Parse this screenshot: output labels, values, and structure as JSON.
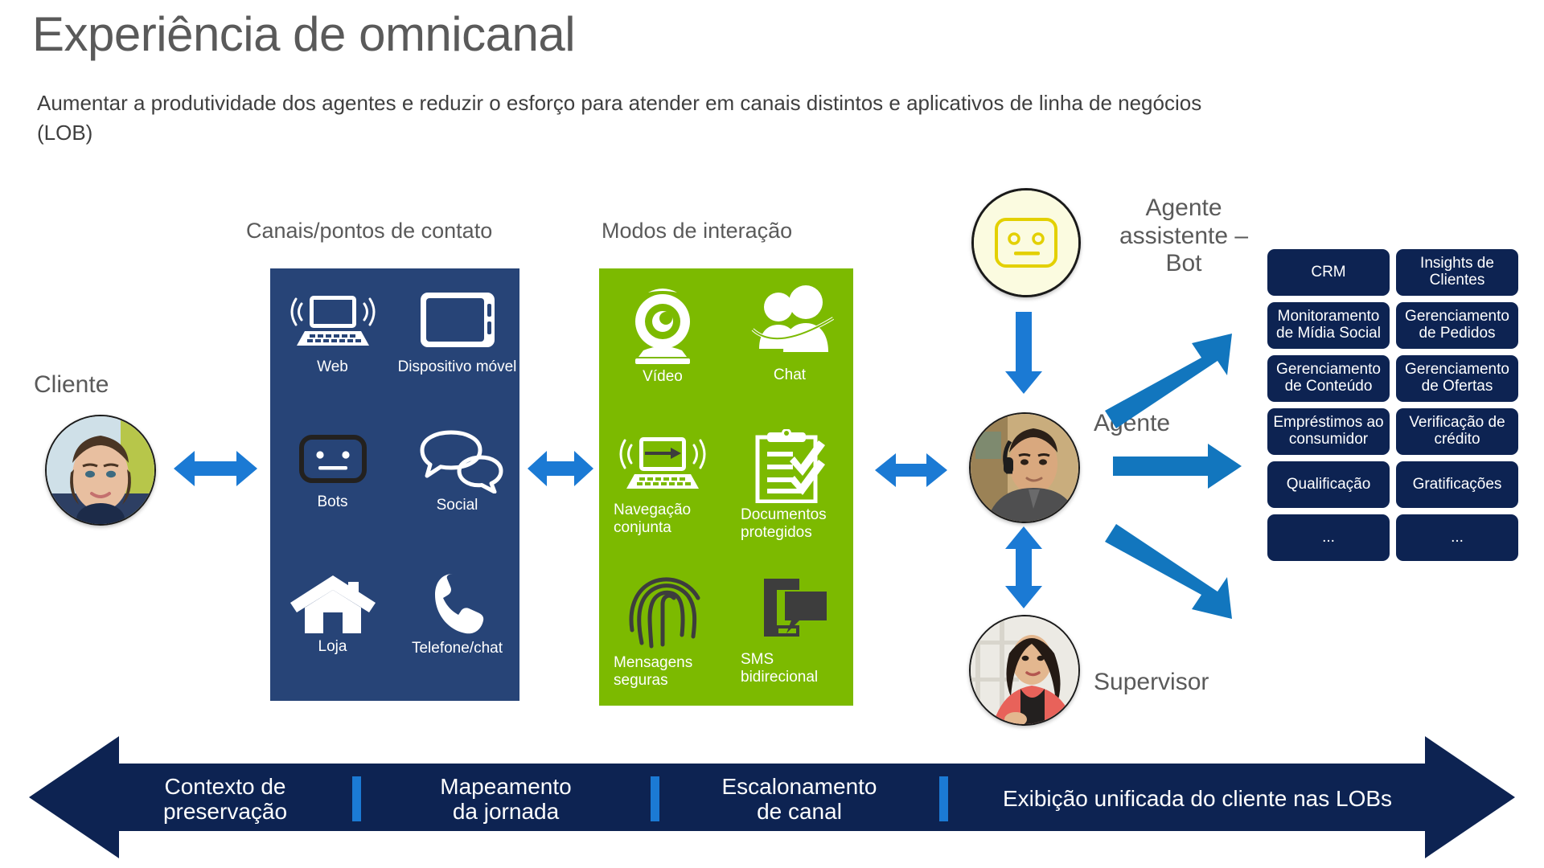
{
  "header": {
    "title": "Experiência de omnicanal",
    "subtitle": "Aumentar a produtividade dos agentes e reduzir o esforço para atender em canais distintos e aplicativos de linha de negócios (LOB)"
  },
  "sections": {
    "channels_caption": "Canais/pontos de contato",
    "modes_caption": "Modos de interação"
  },
  "colors": {
    "channels_panel": "#274477",
    "modes_panel": "#7cba00",
    "lob_box": "#0d2352",
    "arrow_blue": "#1b7ad4",
    "banner_navy": "#0d2352",
    "title_gray": "#5a5a5a"
  },
  "channels": [
    {
      "label": "Web",
      "icon": "laptop-wireless-icon"
    },
    {
      "label": "Dispositivo\nmóvel",
      "icon": "tablet-icon"
    },
    {
      "label": "Bots",
      "icon": "bot-face-icon"
    },
    {
      "label": "Social",
      "icon": "speech-bubbles-icon"
    },
    {
      "label": "Loja",
      "icon": "store-home-icon"
    },
    {
      "label": "Telefone/chat",
      "icon": "phone-handset-icon"
    }
  ],
  "modes": [
    {
      "label": "Vídeo",
      "icon": "webcam-icon"
    },
    {
      "label": "Chat",
      "icon": "people-chat-icon"
    },
    {
      "label": "Navegação\nconjunta",
      "icon": "cobrowse-laptop-icon"
    },
    {
      "label": "Documentos\nprotegidos",
      "icon": "clipboard-check-icon"
    },
    {
      "label": "Mensagens\nseguras",
      "icon": "fingerprint-icon"
    },
    {
      "label": "SMS\nbidirecional",
      "icon": "sms-phone-icon"
    }
  ],
  "people": {
    "customer": "Cliente",
    "bot": "Agente\nassistente –\nBot",
    "agent": "Agente",
    "supervisor": "Supervisor"
  },
  "lob_boxes": [
    "CRM",
    "Insights de Clientes",
    "Monitoramento de Mídia Social",
    "Gerenciamento de Pedidos",
    "Gerenciamento de Conteúdo",
    "Gerenciamento de Ofertas",
    "Empréstimos ao consumidor",
    "Verificação de crédito",
    "Qualificação",
    "Gratificações",
    "...",
    "..."
  ],
  "journey_steps": [
    "Contexto de\npreservação",
    "Mapeamento\nda jornada",
    "Escalonamento\nde canal",
    "Exibição unificada do cliente nas LOBs"
  ]
}
